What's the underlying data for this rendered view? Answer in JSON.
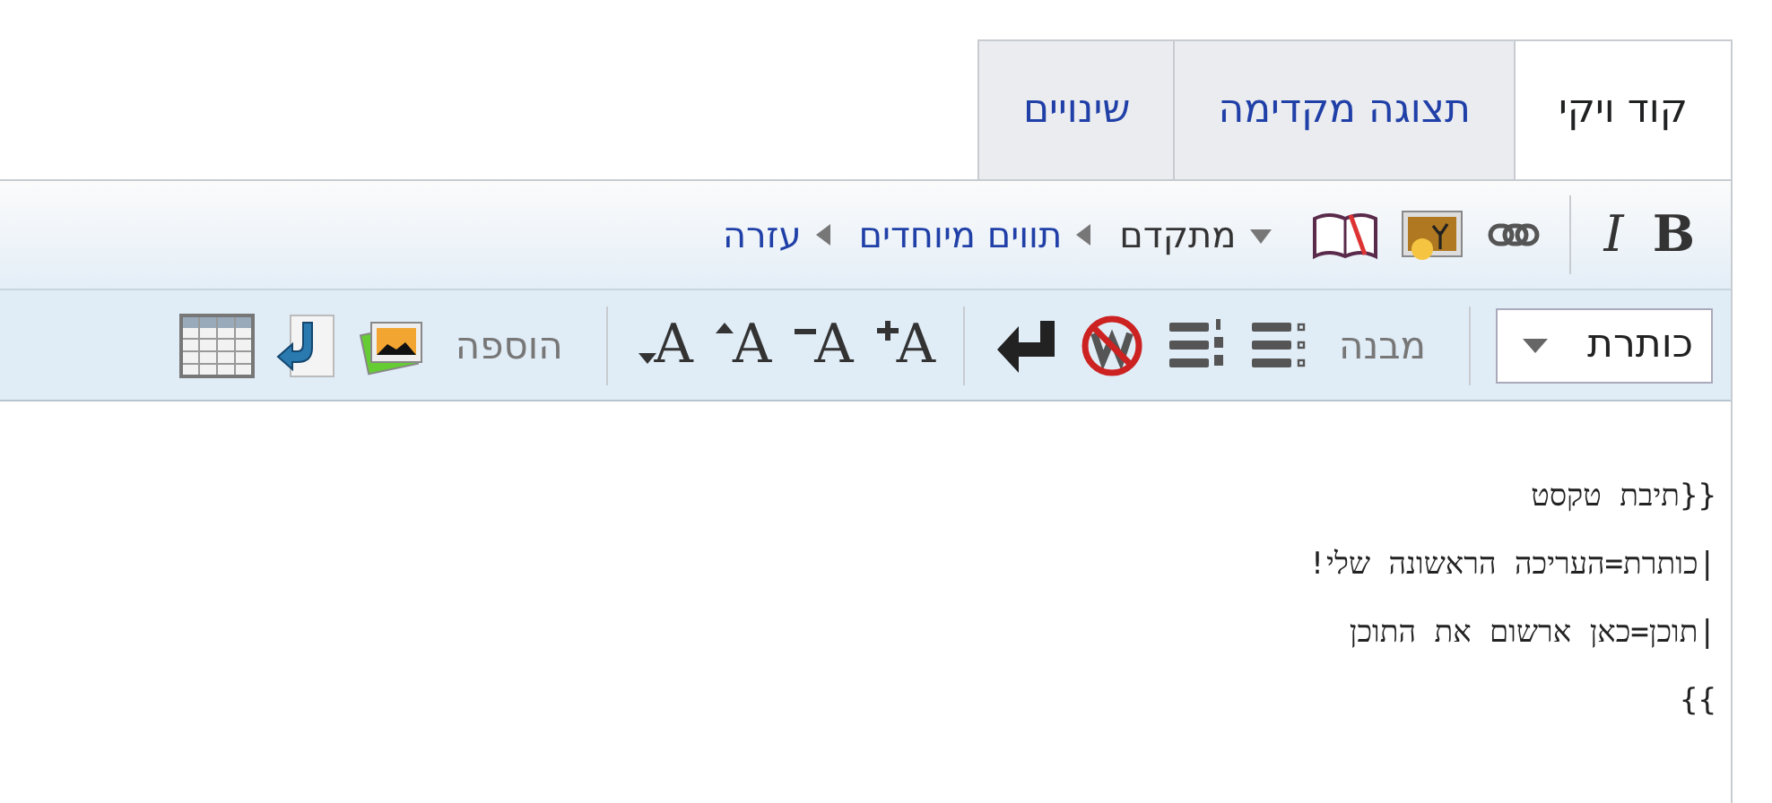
{
  "tabs": [
    {
      "label": "קוד ויקי",
      "selected": true
    },
    {
      "label": "תצוגה מקדימה",
      "selected": false
    },
    {
      "label": "שינויים",
      "selected": false
    }
  ],
  "toolbar": {
    "format_buttons": [
      {
        "kind": "bold",
        "label": "B"
      },
      {
        "kind": "italic",
        "label": "I"
      }
    ],
    "sections": [
      {
        "label": "מתקדם",
        "expanded": true
      },
      {
        "label": "תווים מיוחדים",
        "expanded": false
      },
      {
        "label": "עזרה",
        "expanded": false
      }
    ]
  },
  "advanced": {
    "heading_dropdown": {
      "value": "כותרת"
    },
    "structure_group": {
      "label": "מבנה"
    },
    "font_buttons": [
      {
        "kind": "big",
        "label": "A"
      },
      {
        "kind": "small",
        "label": "A"
      },
      {
        "kind": "superscript",
        "label": "A"
      },
      {
        "kind": "subscript",
        "label": "A"
      }
    ],
    "insert_group": {
      "label": "הוספה"
    }
  },
  "editor": {
    "lines": [
      "{{תיבת טקסט",
      "|כותרת=העריכה הראשונה שלי!",
      "|תוכן=כאן ארשום את התוכן",
      "}}"
    ]
  }
}
